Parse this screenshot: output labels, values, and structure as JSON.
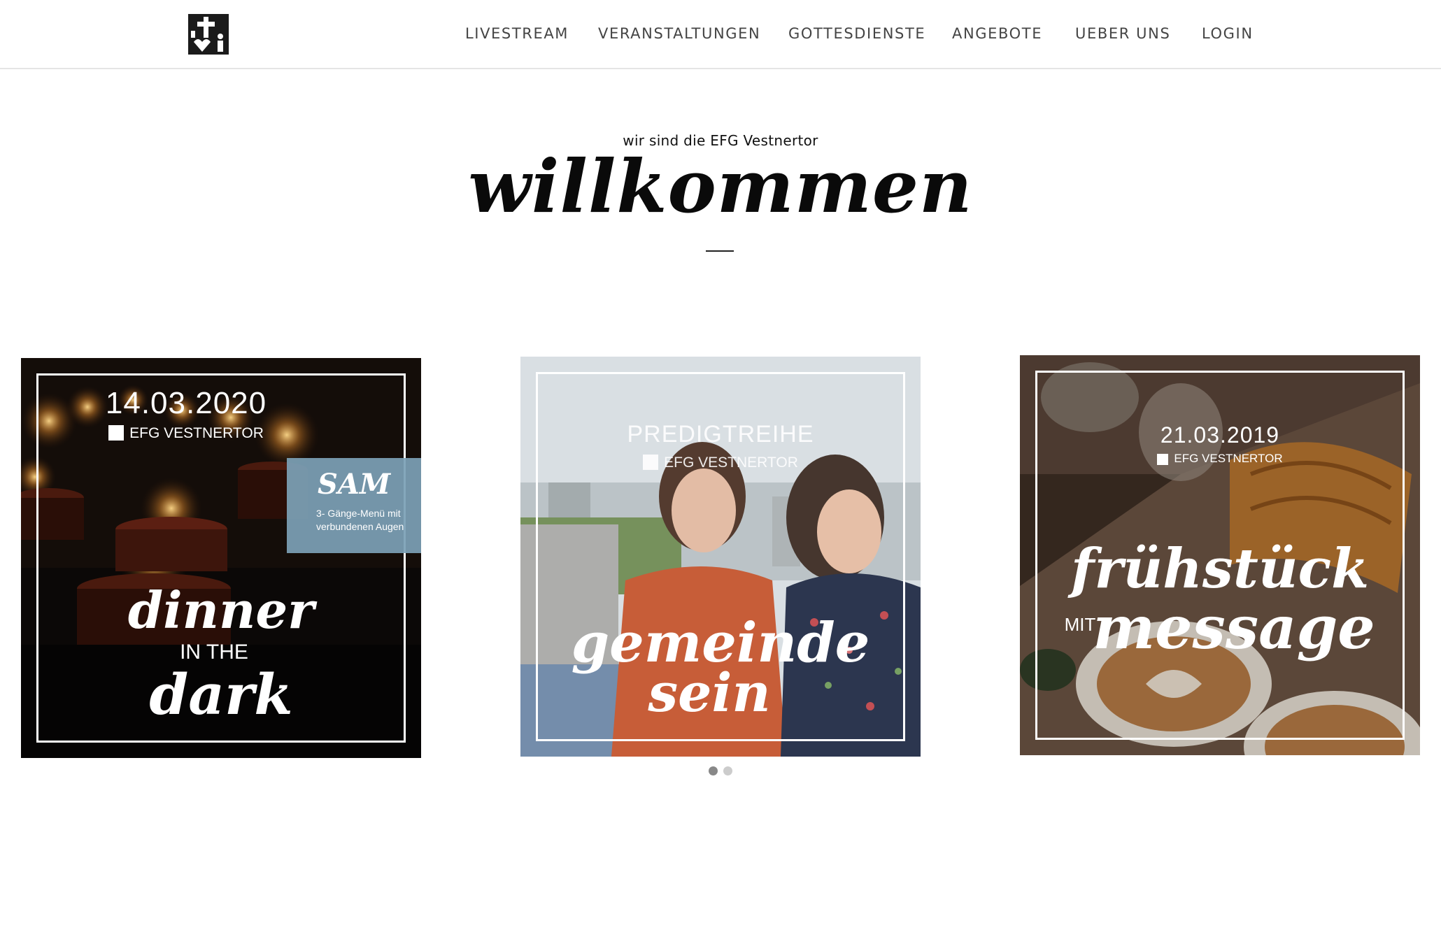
{
  "header": {
    "logo_icon": "efg-vestnertor-logo",
    "nav": [
      "LIVESTREAM",
      "VERANSTALTUNGEN",
      "GOTTESDIENSTE",
      "ANGEBOTE",
      "UEBER UNS",
      "LOGIN"
    ]
  },
  "intro": {
    "tagline": "wir sind die EFG Vestnertor",
    "title": "willkommen"
  },
  "cards": [
    {
      "date": "14.03.2020",
      "org": "EFG VESTNERTOR",
      "badge_title": "SAM",
      "badge_text": "3- Gänge-Menü mit verbundenen Augen",
      "script_1": "dinner",
      "small": "IN THE",
      "script_2": "dark"
    },
    {
      "kicker": "PREDIGTREIHE",
      "org": "EFG VESTNERTOR",
      "script_1": "gemeinde",
      "script_2": "sein"
    },
    {
      "date": "21.03.2019",
      "org": "EFG VESTNERTOR",
      "script_1": "frühstück",
      "small": "MIT",
      "script_2": "message"
    }
  ],
  "carousel": {
    "pages": 2,
    "active": 1
  },
  "colors": {
    "accent_badge": "#7ca0b6",
    "dot_active": "#888888",
    "dot_inactive": "#cccccc"
  }
}
